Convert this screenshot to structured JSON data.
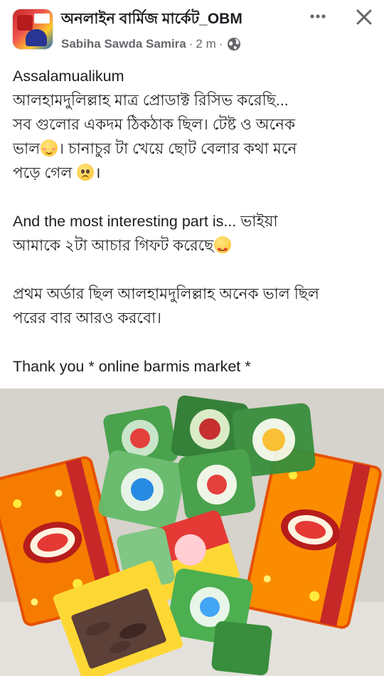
{
  "post": {
    "group_name": "অনলাইন বার্মিজ মার্কেট_OBM",
    "author": "Sabiha Sawda Samira",
    "time": "2 m",
    "separator": "·",
    "body": {
      "line1": "Assalamualikum",
      "line2": "আলহামদুলিল্লাহ মাত্র প্রোডাক্ট রিসিভ করেছি...",
      "line3": "সব গুলোর একদম ঠিকঠাক ছিল। টেষ্ট ও অনেক",
      "line4a": "ভাল",
      "line4b": "। চানাচুর টা খেয়ে ছোট বেলার কথা মনে",
      "line5a": "পড়ে গেল ",
      "line5b": "।",
      "para2_line1": "And the most interesting part is... ভাইয়া",
      "para2_line2": "আমাকে ২টা আচার গিফট করেছে",
      "para3_line1": "প্রথম অর্ডার ছিল আলহামদুলিল্লাহ অনেক ভাল ছিল",
      "para3_line2": "পরের বার আরও করবো।",
      "para4": "Thank you * online barmis market *"
    }
  },
  "icons": {
    "more": "more-horizontal-icon",
    "close": "close-icon",
    "globe": "globe-icon"
  },
  "colors": {
    "text": "#1c1e21",
    "secondary": "#65676b"
  }
}
